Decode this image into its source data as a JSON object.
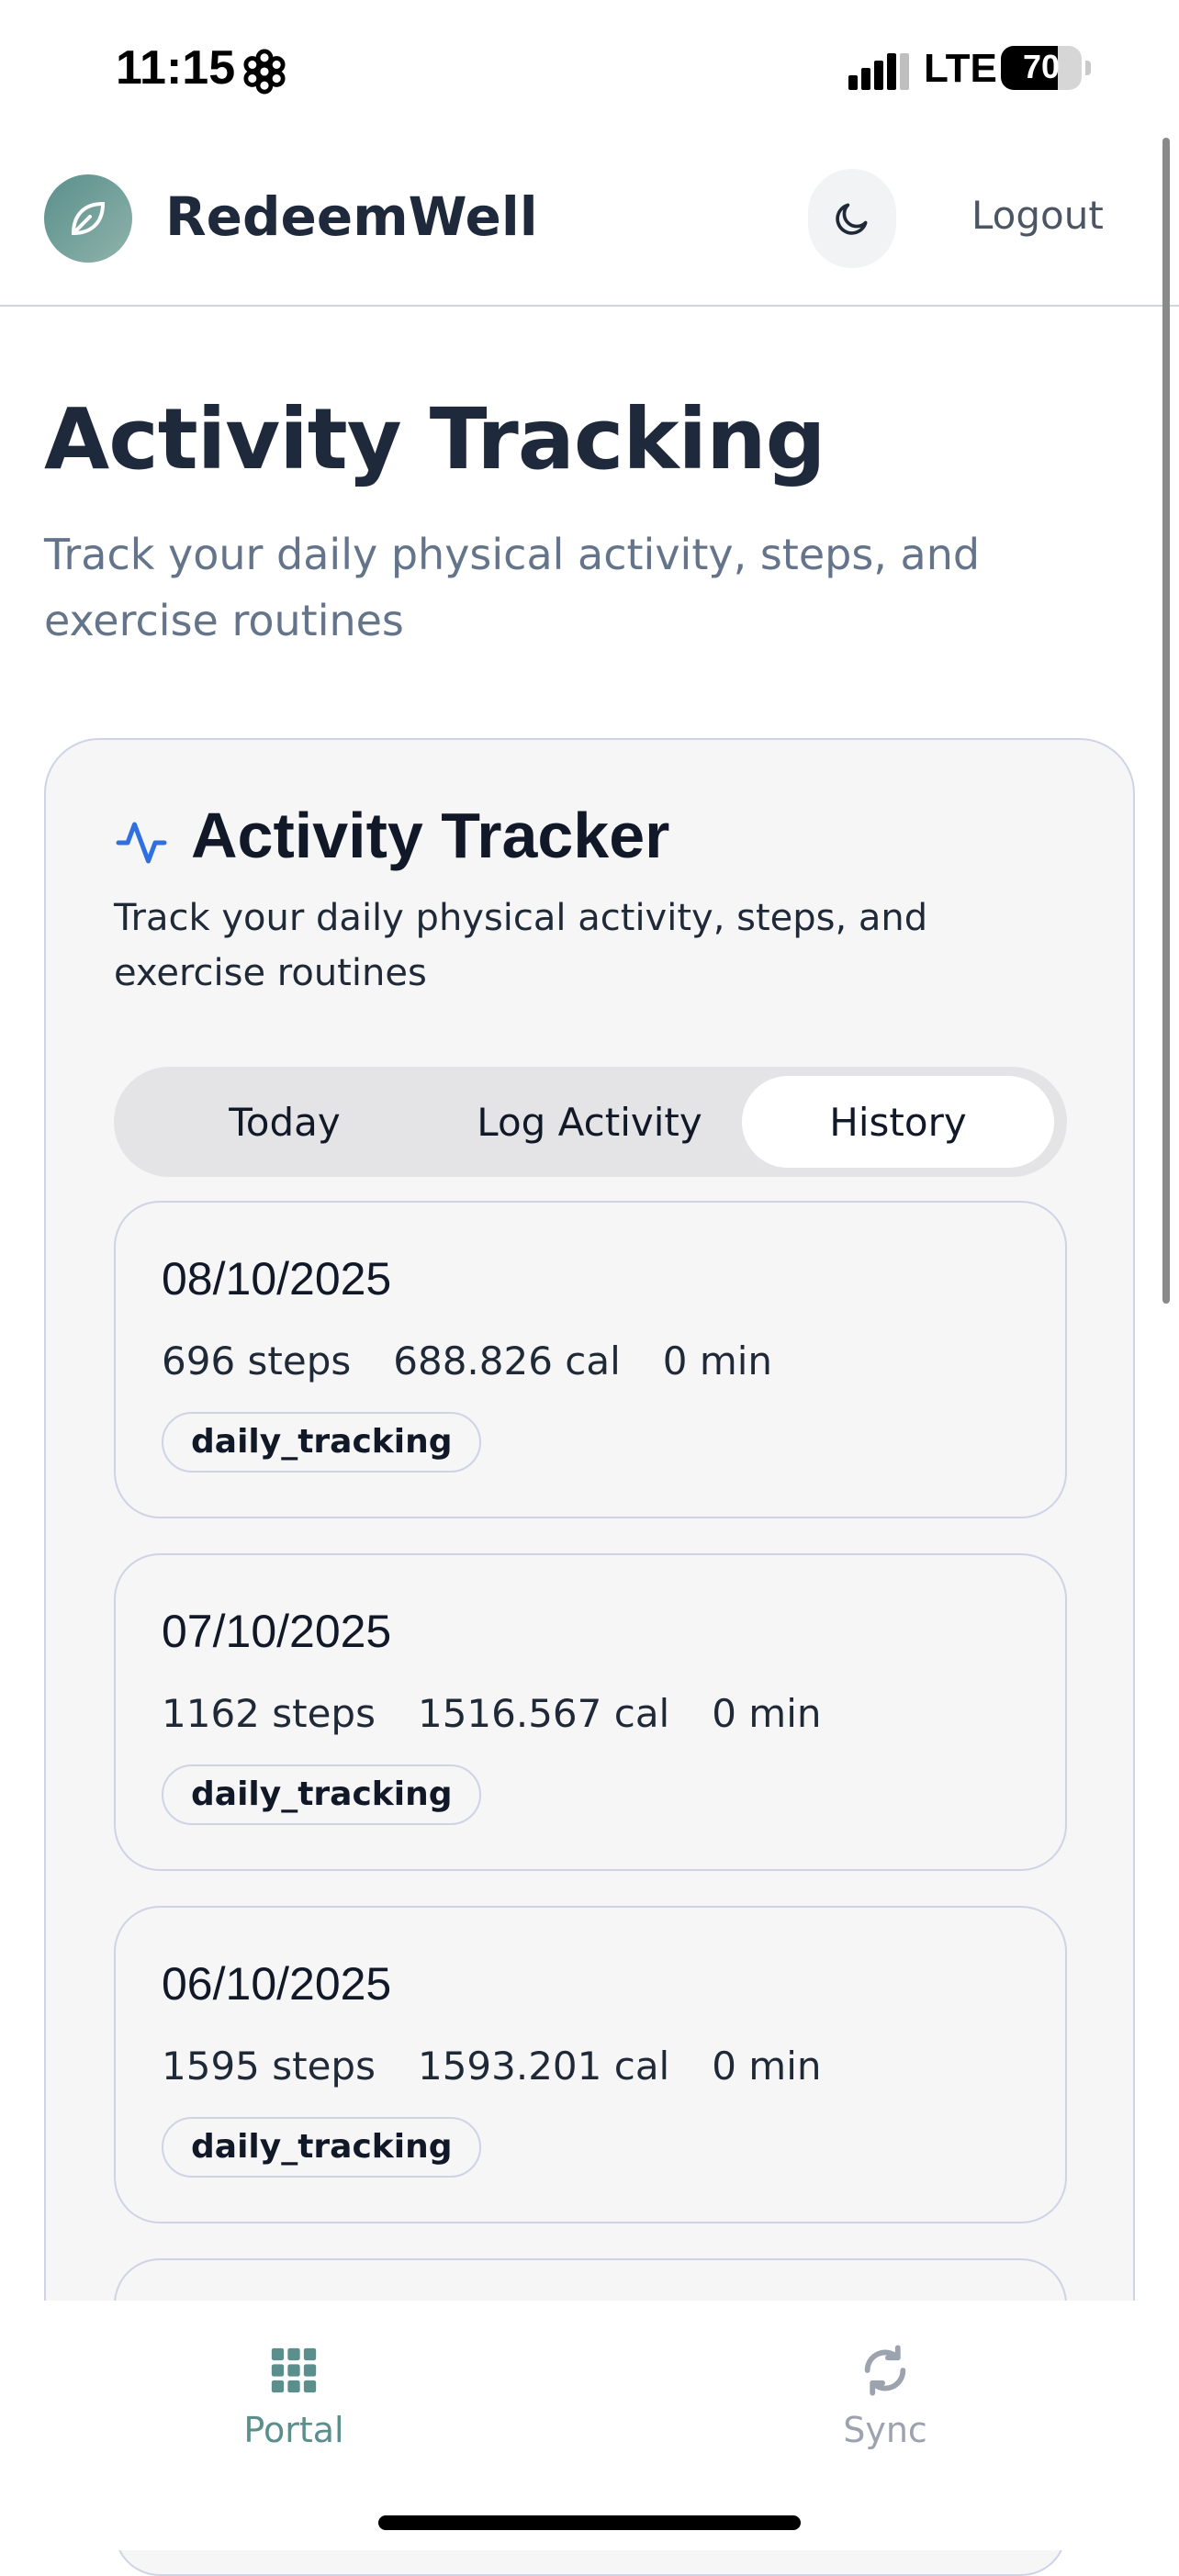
{
  "status_bar": {
    "time": "11:15",
    "network": "LTE",
    "battery": "70",
    "battery_level": 0.7
  },
  "header": {
    "brand": "RedeemWell",
    "logout_label": "Logout"
  },
  "page": {
    "title": "Activity Tracking",
    "subtitle": "Track your daily physical activity, steps, and exercise routines"
  },
  "tracker": {
    "title": "Activity Tracker",
    "description": "Track your daily physical activity, steps, and exercise routines",
    "tabs": [
      {
        "label": "Today"
      },
      {
        "label": "Log Activity"
      },
      {
        "label": "History"
      }
    ],
    "active_tab": "History",
    "history": [
      {
        "date": "08/10/2025",
        "steps": "696 steps",
        "calories": "688.826 cal",
        "duration": "0 min",
        "tag": "daily_tracking"
      },
      {
        "date": "07/10/2025",
        "steps": "1162 steps",
        "calories": "1516.567 cal",
        "duration": "0 min",
        "tag": "daily_tracking"
      },
      {
        "date": "06/10/2025",
        "steps": "1595 steps",
        "calories": "1593.201 cal",
        "duration": "0 min",
        "tag": "daily_tracking"
      }
    ]
  },
  "bottom_nav": {
    "items": [
      {
        "label": "Portal",
        "icon": "grid-icon"
      },
      {
        "label": "Sync",
        "icon": "sync-icon"
      }
    ]
  },
  "colors": {
    "accent": "#5a8f8c",
    "activity_icon": "#2f6fe0",
    "nav_inactive": "#9ca3af"
  }
}
